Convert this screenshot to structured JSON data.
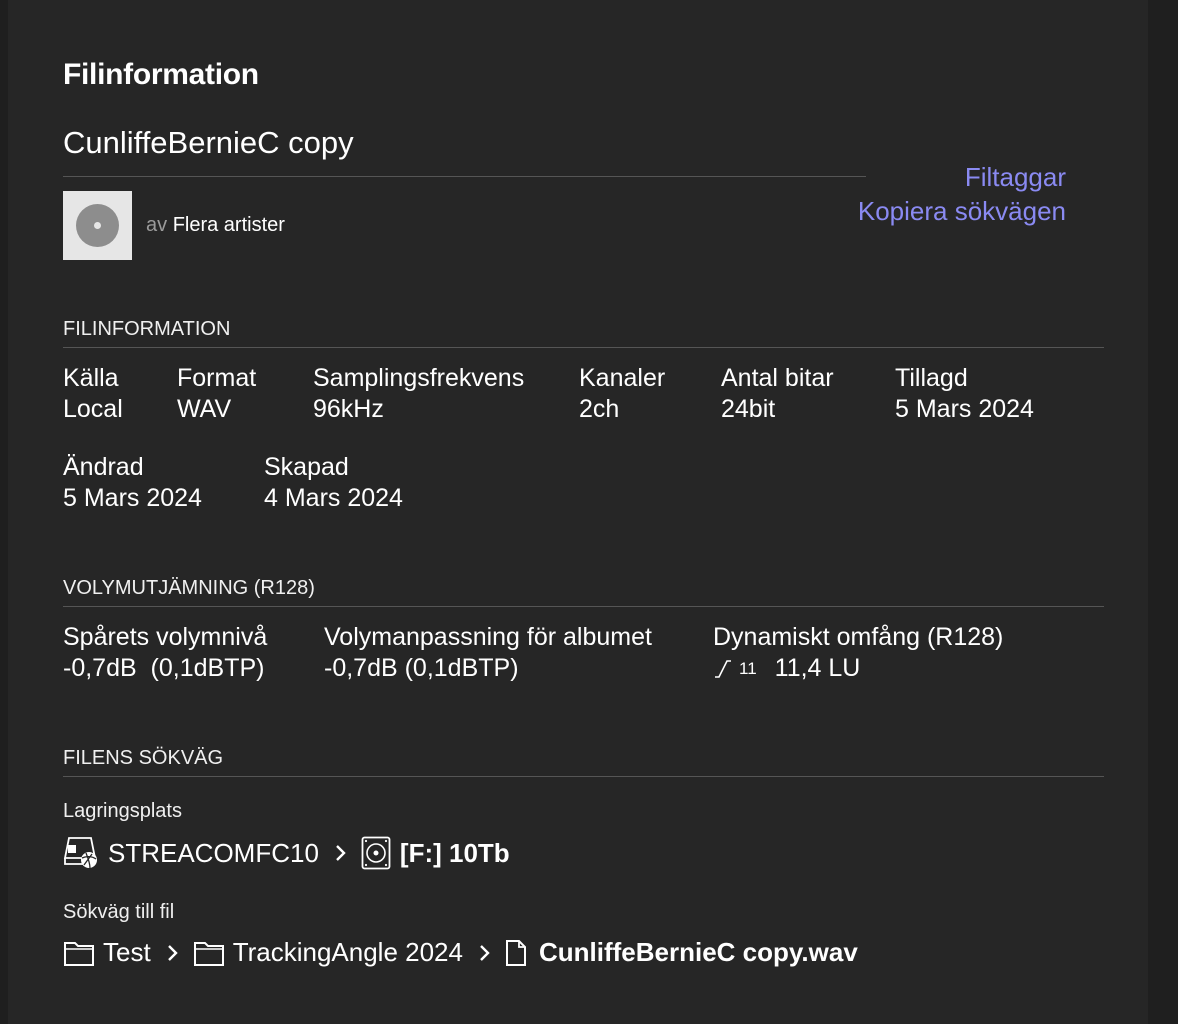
{
  "header": {
    "title": "Filinformation",
    "filename": "CunliffeBernieC copy",
    "artist_prefix": "av",
    "artist": "Flera artister",
    "link_tags": "Filtaggar",
    "link_copy_path": "Kopiera sökvägen"
  },
  "file_info": {
    "section_title": "FILINFORMATION",
    "fields": [
      {
        "label": "Källa",
        "value": "Local"
      },
      {
        "label": "Format",
        "value": "WAV"
      },
      {
        "label": "Samplingsfrekvens",
        "value": "96kHz"
      },
      {
        "label": "Kanaler",
        "value": "2ch"
      },
      {
        "label": "Antal bitar",
        "value": "24bit"
      },
      {
        "label": "Tillagd",
        "value": "5 Mars 2024"
      },
      {
        "label": "Ändrad",
        "value": "5 Mars 2024"
      },
      {
        "label": "Skapad",
        "value": "4 Mars 2024"
      }
    ]
  },
  "volume": {
    "section_title": "VOLYMUTJÄMNING (R128)",
    "track_label": "Spårets volymnivå",
    "track_value": "-0,7dB  (0,1dBTP)",
    "album_label": "Volymanpassning för albumet",
    "album_value": "-0,7dB (0,1dBTP)",
    "dr_label": "Dynamiskt omfång (R128)",
    "dr_badge": "11",
    "dr_value": "11,4 LU"
  },
  "path": {
    "section_title": "FILENS SÖKVÄG",
    "storage_label": "Lagringsplats",
    "storage_device": "STREACOMFC10",
    "storage_drive": "[F:] 10Tb",
    "file_path_label": "Sökväg till fil",
    "folder1": "Test",
    "folder2": "TrackingAngle 2024",
    "file": "CunliffeBernieC copy.wav"
  },
  "colors": {
    "background": "#262626",
    "link": "#8a8af2",
    "text": "#ffffff"
  }
}
